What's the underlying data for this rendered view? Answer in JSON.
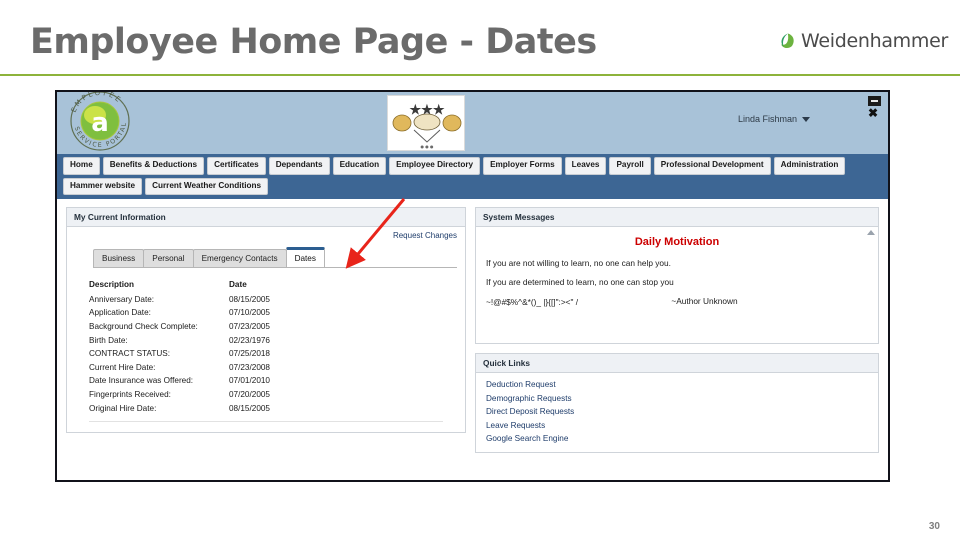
{
  "slide": {
    "title": "Employee Home Page - Dates",
    "page_number": "30",
    "brand": "Weidenhammer",
    "accent_green": "#8db33b",
    "title_color": "#6b6b6b"
  },
  "app": {
    "banner": {
      "logo_alt": "Employee Service Portal",
      "logo_top_text": "EMPLOYEE",
      "logo_bottom_text": "SERVICE PORTAL",
      "logo_letter": "a",
      "user_name": "Linda Fishman",
      "minimize_label": "_",
      "close_label": "✖"
    },
    "nav": {
      "row1": [
        "Home",
        "Benefits & Deductions",
        "Certificates",
        "Dependants",
        "Education",
        "Employee Directory",
        "Employer Forms",
        "Leaves",
        "Payroll",
        "Professional Development",
        "Administration",
        "Hammer website"
      ],
      "row2": [
        "Current Weather Conditions"
      ],
      "bar_color": "#3d6694"
    },
    "left_panel": {
      "header": "My Current Information",
      "request_changes": "Request Changes",
      "tabs": [
        {
          "label": "Business",
          "active": false
        },
        {
          "label": "Personal",
          "active": false
        },
        {
          "label": "Emergency Contacts",
          "active": false
        },
        {
          "label": "Dates",
          "active": true
        }
      ],
      "table": {
        "columns": [
          "Description",
          "Date"
        ],
        "rows": [
          {
            "description": "Anniversary Date:",
            "date": "08/15/2005"
          },
          {
            "description": "Application Date:",
            "date": "07/10/2005"
          },
          {
            "description": "Background Check Complete:",
            "date": "07/23/2005"
          },
          {
            "description": "Birth Date:",
            "date": "02/23/1976"
          },
          {
            "description": "CONTRACT STATUS:",
            "date": "07/25/2018"
          },
          {
            "description": "Current Hire Date:",
            "date": "07/23/2008"
          },
          {
            "description": "Date Insurance was Offered:",
            "date": "07/01/2010"
          },
          {
            "description": "Fingerprints Received:",
            "date": "07/20/2005"
          },
          {
            "description": "Original Hire Date:",
            "date": "08/15/2005"
          }
        ]
      }
    },
    "system_messages": {
      "header": "System Messages",
      "title": "Daily Motivation",
      "title_color": "#cc0000",
      "line1": "If you are not willing to learn, no one can help you.",
      "line2": "If you are determined to learn, no one can stop you",
      "author": "~Author Unknown",
      "garbled": "~!@#$%^&*()_ |}{[]\":><\"   /"
    },
    "quick_links": {
      "header": "Quick Links",
      "links": [
        "Deduction Request",
        "Demographic Requests",
        "Direct Deposit Requests",
        "Leave Requests",
        "Google Search Engine"
      ],
      "link_color": "#1f3d6b"
    },
    "annotation": {
      "type": "arrow",
      "color": "#e8241a",
      "points_to": "Dates"
    }
  }
}
